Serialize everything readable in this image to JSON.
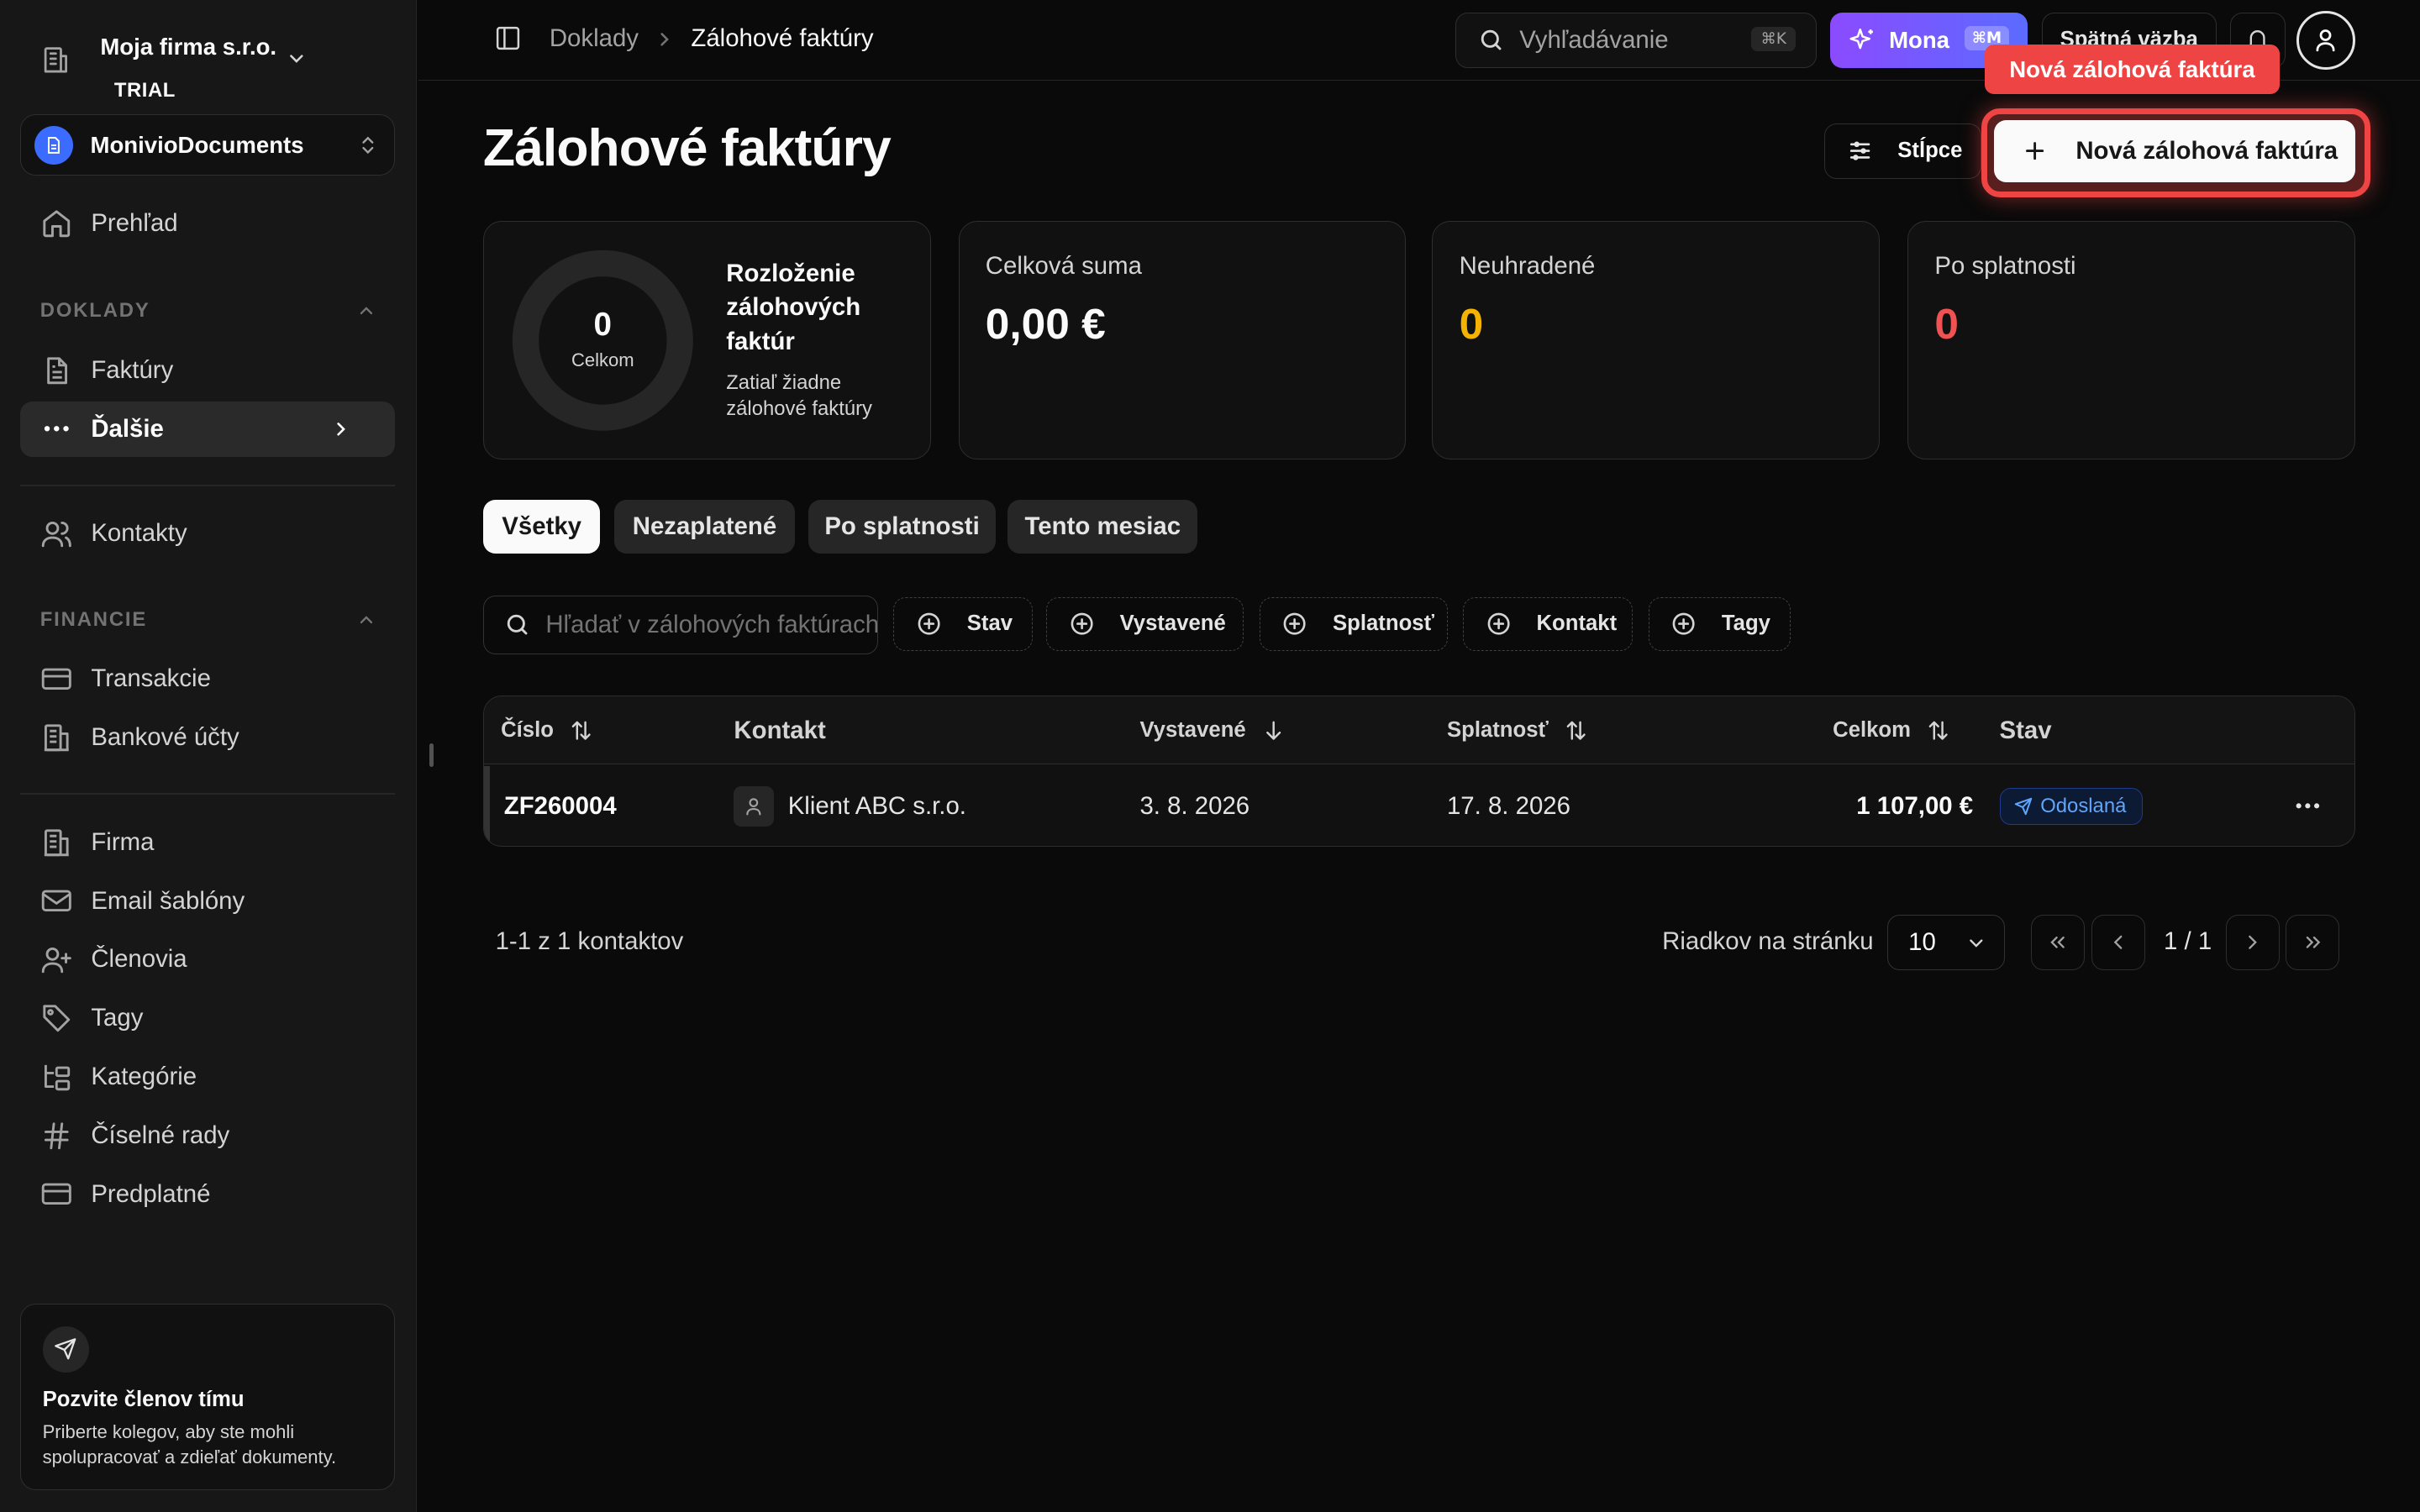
{
  "sidebar": {
    "org_name": "Moja firma s.r.o.",
    "org_plan": "TRIAL",
    "workspace": "MonivioDocuments",
    "overview": "Prehľad",
    "section_documents": "DOKLADY",
    "invoices": "Faktúry",
    "more": "Ďalšie",
    "contacts": "Kontakty",
    "section_finance": "FINANCIE",
    "transactions": "Transakcie",
    "bank_accounts": "Bankové účty",
    "company": "Firma",
    "email_templates": "Email šablóny",
    "members": "Členovia",
    "tags": "Tagy",
    "categories": "Kategórie",
    "number_series": "Číselné rady",
    "subscription": "Predplatné",
    "invite_title": "Pozvite členov tímu",
    "invite_text": "Priberte kolegov, aby ste mohli spolupracovať a zdieľať dokumenty."
  },
  "topbar": {
    "breadcrumb_parent": "Doklady",
    "breadcrumb_current": "Zálohové faktúry",
    "search_placeholder": "Vyhľadávanie",
    "search_kbd": "⌘K",
    "mona_label": "Mona",
    "mona_kbd": "⌘M",
    "feedback_label": "Spätná väzba"
  },
  "header": {
    "title": "Zálohové faktúry",
    "columns_button": "Stĺpce",
    "new_button": "Nová zálohová faktúra",
    "tooltip": "Nová zálohová faktúra"
  },
  "stats": {
    "donut_value": "0",
    "donut_label": "Celkom",
    "distribution_title": "Rozloženie zálohových faktúr",
    "distribution_sub": "Zatiaľ žiadne zálohové faktúry",
    "total_label": "Celková suma",
    "total_value": "0,00 €",
    "unpaid_label": "Neuhradené",
    "unpaid_value": "0",
    "overdue_label": "Po splatnosti",
    "overdue_value": "0"
  },
  "colors": {
    "unpaid": "#f5b301",
    "overdue": "#f05252"
  },
  "tabs": [
    "Všetky",
    "Nezaplatené",
    "Po splatnosti",
    "Tento mesiac"
  ],
  "filters": {
    "search_placeholder": "Hľadať v zálohových faktúrach",
    "chips": [
      "Stav",
      "Vystavené",
      "Splatnosť",
      "Kontakt",
      "Tagy"
    ]
  },
  "table": {
    "columns": [
      "Číslo",
      "Kontakt",
      "Vystavené",
      "Splatnosť",
      "Celkom",
      "Stav"
    ],
    "rows": [
      {
        "number": "ZF260004",
        "contact": "Klient ABC s.r.o.",
        "issued": "3. 8. 2026",
        "due": "17. 8. 2026",
        "total": "1 107,00 €",
        "status": "Odoslaná"
      }
    ]
  },
  "pagination": {
    "count_text": "1-1 z 1 kontaktov",
    "rows_per_page_label": "Riadkov na stránku",
    "rows_per_page": "10",
    "page_text": "1 / 1"
  }
}
